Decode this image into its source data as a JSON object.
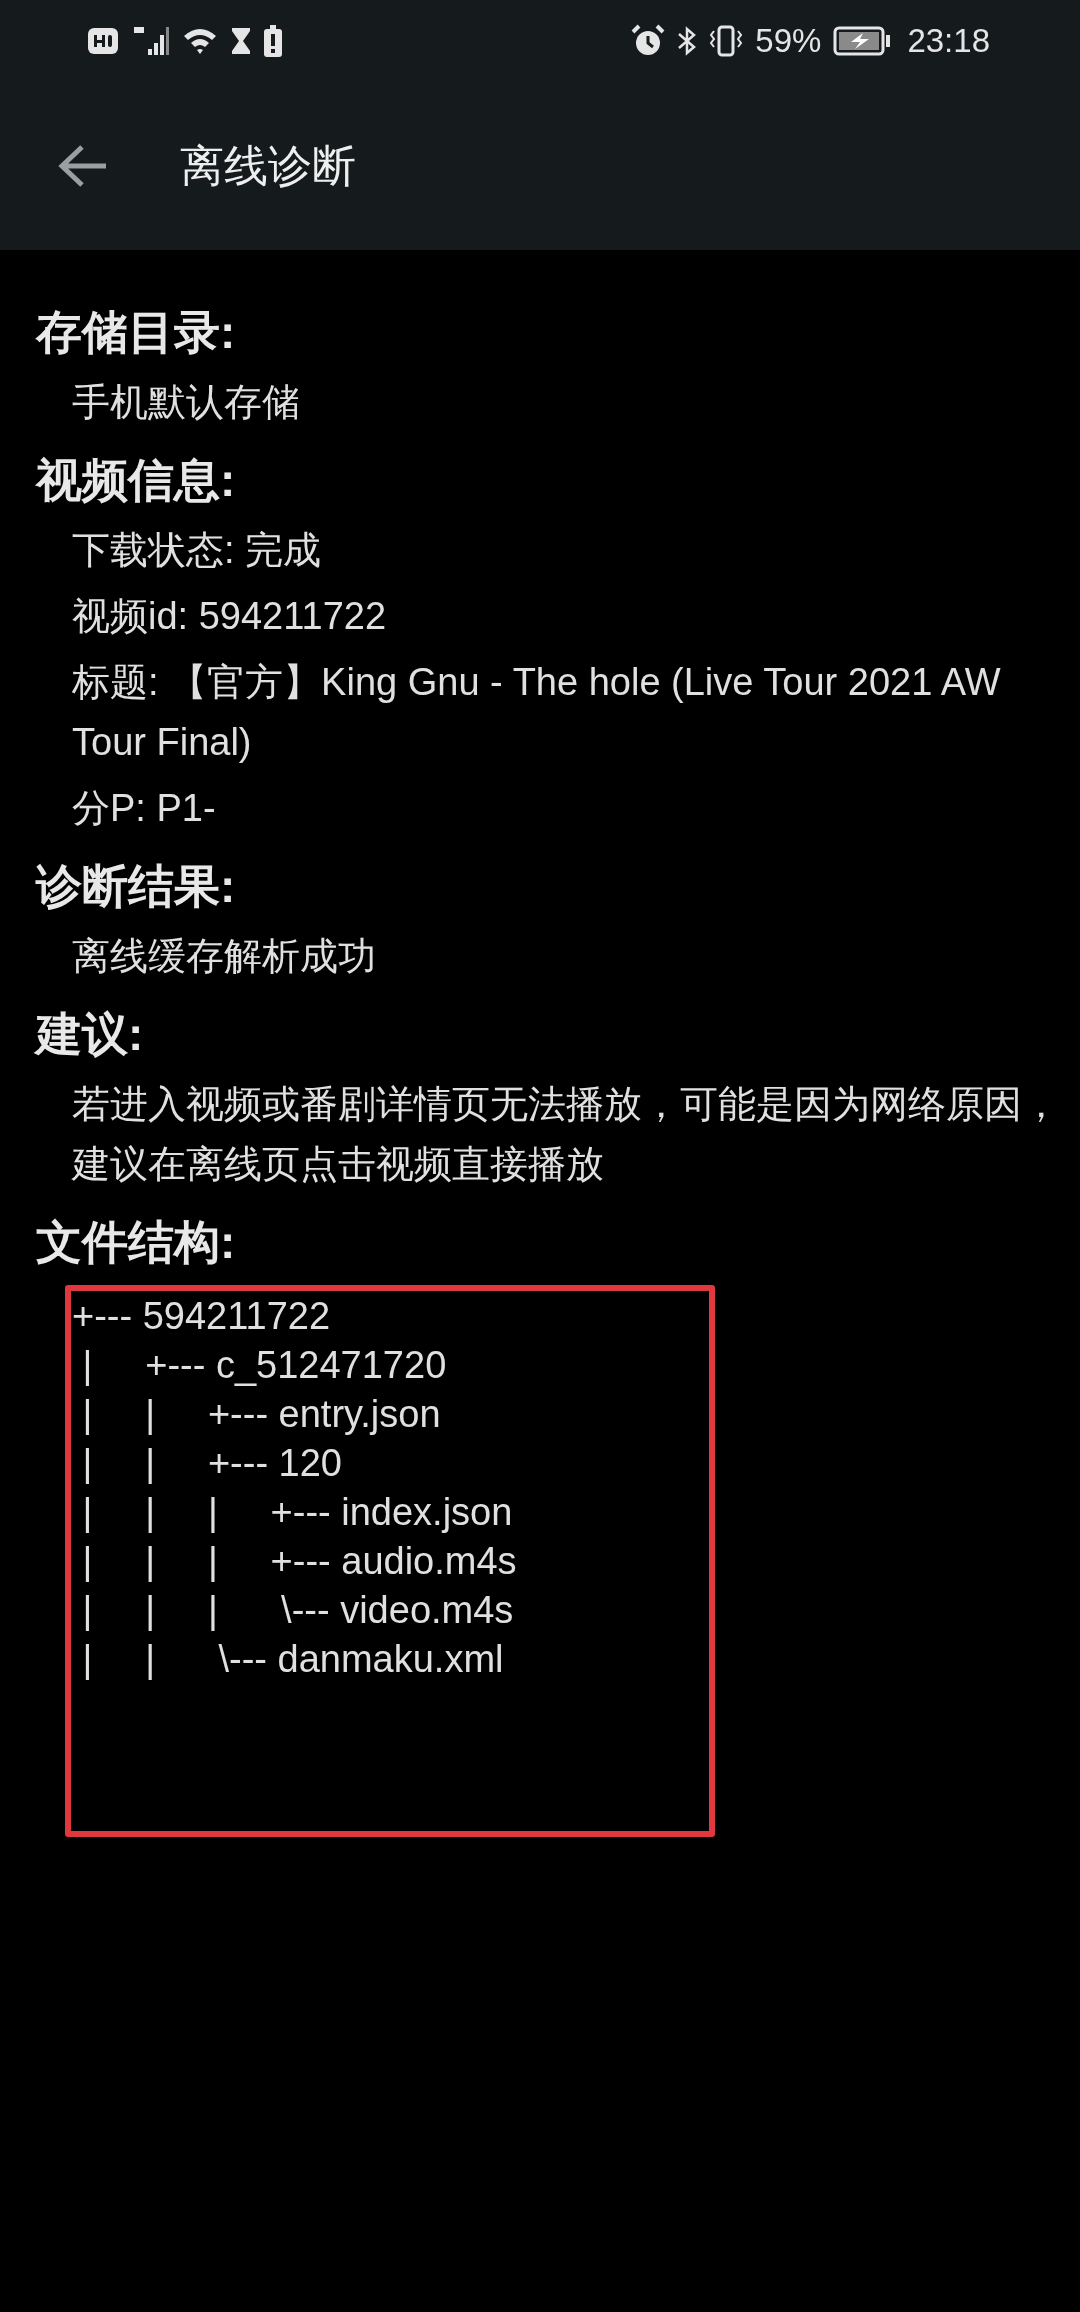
{
  "status_bar": {
    "battery": "59%",
    "time": "23:18"
  },
  "app_bar": {
    "title": "离线诊断"
  },
  "sections": [
    {
      "kind": "text",
      "heading": "存储目录:",
      "lines": [
        "手机默认存储"
      ]
    },
    {
      "kind": "text",
      "heading": "视频信息:",
      "lines": [
        "下载状态: 完成",
        "视频id: 594211722",
        "标题: 【官方】King Gnu - The hole (Live Tour 2021 AW Tour Final)",
        "分P: P1-"
      ]
    },
    {
      "kind": "text",
      "heading": "诊断结果:",
      "lines": [
        "离线缓存解析成功"
      ]
    },
    {
      "kind": "text",
      "heading": "建议:",
      "lines": [
        "若进入视频或番剧详情页无法播放，可能是因为网络原因，建议在离线页点击视频直接播放"
      ]
    },
    {
      "kind": "tree",
      "heading": "文件结构:",
      "lines": [
        "+--- 594211722",
        " |     +--- c_512471720",
        " |     |     +--- entry.json",
        " |     |     +--- 120",
        " |     |     |     +--- index.json",
        " |     |     |     +--- audio.m4s",
        " |     |     |      \\--- video.m4s",
        " |     |      \\--- danmaku.xml"
      ]
    }
  ]
}
